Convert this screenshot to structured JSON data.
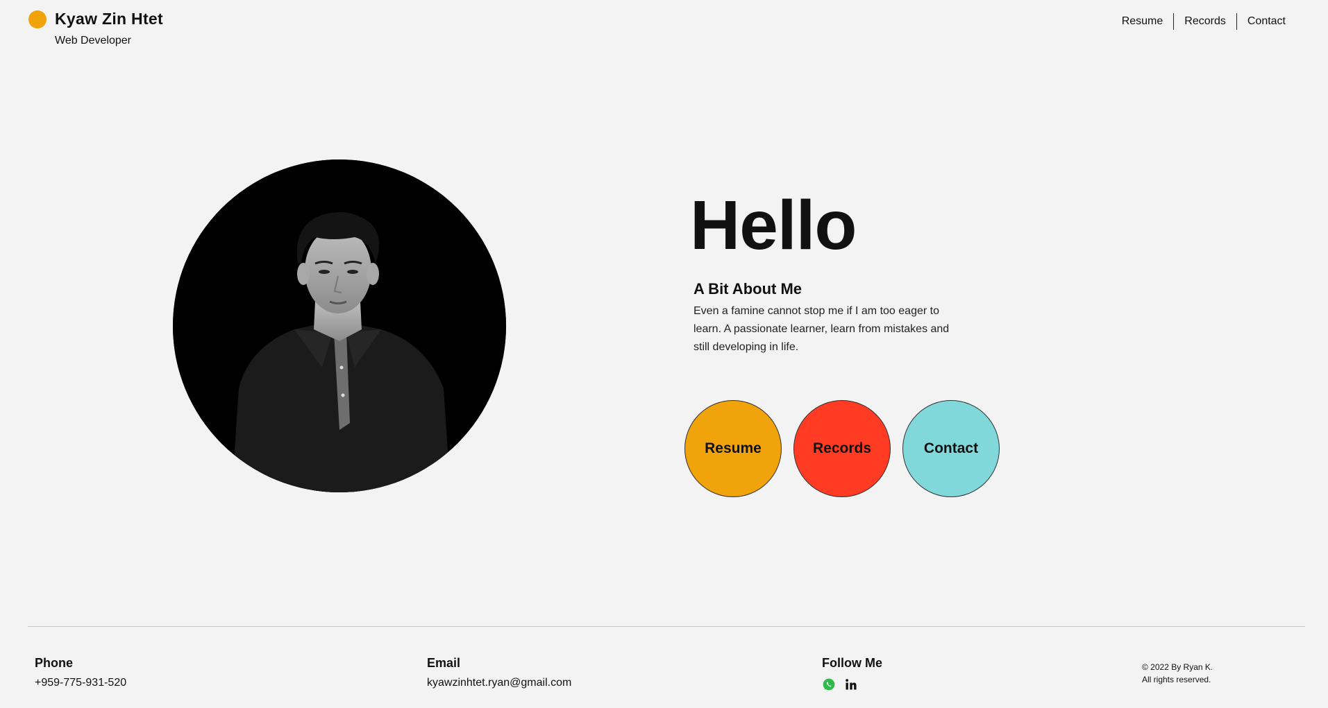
{
  "brand": {
    "name": "Kyaw Zin Htet",
    "role": "Web Developer",
    "accent": "#f0a30a"
  },
  "nav": {
    "items": [
      {
        "label": "Resume"
      },
      {
        "label": "Records"
      },
      {
        "label": "Contact"
      }
    ]
  },
  "hero": {
    "greeting": "Hello",
    "about_title": "A Bit About Me",
    "about_text": "Even a famine cannot stop me if I am too eager to learn. A passionate learner, learn from mistakes and still developing in life."
  },
  "buttons": [
    {
      "label": "Resume",
      "color": "#f0a30a"
    },
    {
      "label": "Records",
      "color": "#ff3b24"
    },
    {
      "label": "Contact",
      "color": "#80d8db"
    }
  ],
  "footer": {
    "phone_label": "Phone",
    "phone": "+959-775-931-520",
    "email_label": "Email",
    "email": "kyawzinhtet.ryan@gmail.com",
    "follow_label": "Follow Me",
    "social_icons": [
      "whatsapp-icon",
      "linkedin-icon"
    ],
    "copyright_line1": "© 2022 By Ryan K.",
    "copyright_line2": "All rights reserved."
  }
}
